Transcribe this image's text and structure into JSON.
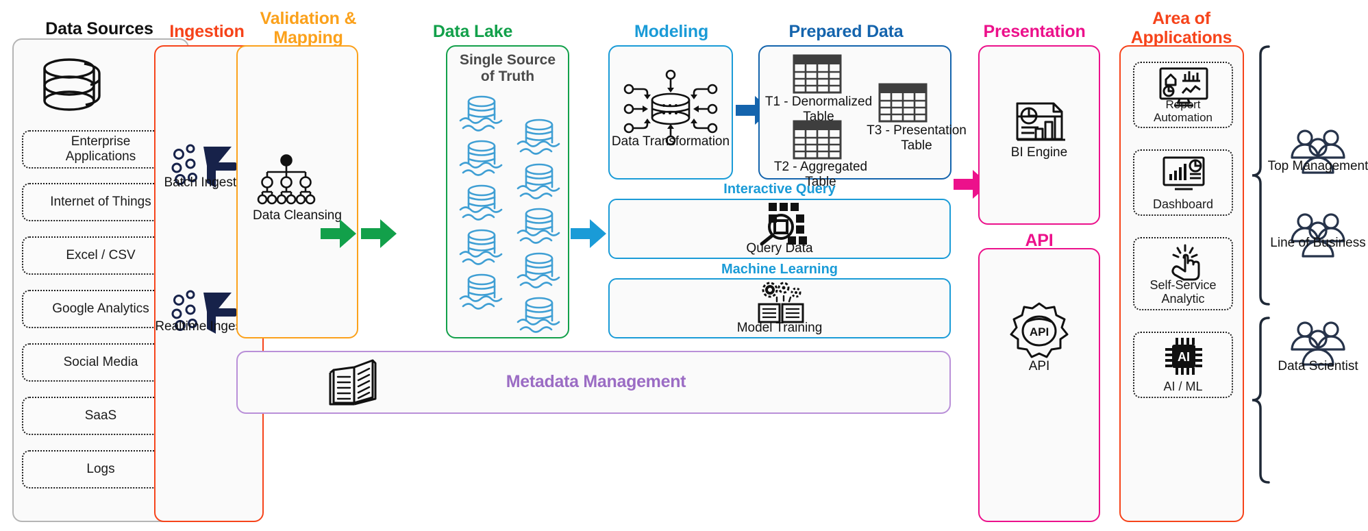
{
  "columns": {
    "data_sources": {
      "title": "Data Sources",
      "title_color": "#111111",
      "border_color": "#b5b5b5",
      "icon": "database-stack-icon",
      "items": [
        "Enterprise\nApplications",
        "Internet of Things",
        "Excel / CSV",
        "Google Analytics",
        "Social Media",
        "SaaS",
        "Logs"
      ]
    },
    "ingestion": {
      "title": "Ingestion",
      "title_color": "#f6431a",
      "border_color": "#f6431a",
      "items": [
        {
          "icon": "funnel-icon",
          "label": "Batch Ingestion"
        },
        {
          "icon": "funnel-icon",
          "label": "Realtime Ingestion"
        }
      ]
    },
    "validation": {
      "title": "Validation &\nMapping",
      "title_color": "#fba11b",
      "border_color": "#fba11b",
      "items": [
        {
          "icon": "hierarchy-tree-icon",
          "label": "Data Cleansing"
        }
      ]
    },
    "data_lake": {
      "title": "Data Lake",
      "title_color": "#12a04a",
      "border_color": "#12a04a",
      "inner_heading": "Single Source\nof Truth",
      "icon": "database-lake-icon",
      "icon_color": "#3f9fd4",
      "left_count": 5,
      "right_count": 5
    },
    "modeling": {
      "title": "Modeling",
      "title_color": "#1a9bd7",
      "border_color": "#1a9bd7",
      "items": [
        {
          "icon": "data-transformation-icon",
          "label": "Data Transformation"
        }
      ]
    },
    "prepared_data": {
      "title": "Prepared Data",
      "title_color": "#1464ad",
      "border_color": "#1464ad",
      "tables": [
        {
          "icon": "table-icon",
          "label": "T1 - Denormalized\nTable"
        },
        {
          "icon": "table-icon",
          "label": "T3 - Presentation\nTable"
        },
        {
          "icon": "table-icon",
          "label": "T2 - Aggregated\nTable"
        }
      ]
    },
    "interactive_query": {
      "title": "Interactive Query",
      "title_color": "#1a9bd7",
      "border_color": "#1a9bd7",
      "icon": "query-search-icon",
      "label": "Query Data"
    },
    "machine_learning": {
      "title": "Machine Learning",
      "title_color": "#1a9bd7",
      "border_color": "#1a9bd7",
      "icon": "model-training-icon",
      "label": "Model Training"
    },
    "metadata": {
      "label": "Metadata Management",
      "label_color": "#9b6cc4",
      "border_color": "#b98fd8",
      "icon": "open-book-icon"
    },
    "presentation": {
      "title": "Presentation",
      "title_color": "#ec118b",
      "border_color": "#ec118b",
      "icon": "bi-report-icon",
      "label": "BI Engine"
    },
    "api": {
      "title": "API",
      "title_color": "#ec118b",
      "border_color": "#ec118b",
      "icon": "api-gear-icon",
      "label": "API",
      "icon_text": "API"
    },
    "applications": {
      "title": "Area of\nApplications",
      "title_color": "#f6431a",
      "border_color": "#f6431a",
      "items": [
        {
          "icon": "report-monitor-icon",
          "label": "Report Automation"
        },
        {
          "icon": "dashboard-monitor-icon",
          "label": "Dashboard"
        },
        {
          "icon": "pointing-hand-icon",
          "label": "Self-Service\nAnalytic"
        },
        {
          "icon": "ai-chip-icon",
          "label": "AI / ML",
          "icon_text": "AI"
        }
      ]
    },
    "personas": {
      "items": [
        {
          "icon": "people-group-icon",
          "label": "Top Management"
        },
        {
          "icon": "people-group-icon",
          "label": "Line of Business"
        },
        {
          "icon": "people-group-icon",
          "label": "Data Scientist"
        }
      ]
    }
  },
  "arrows": [
    {
      "name": "arrow-sources-to-ingestion",
      "color": "#f6431a"
    },
    {
      "name": "arrow-ingestion-to-validation",
      "color": "#fba11b"
    },
    {
      "name": "arrow-validation-to-datalake",
      "color": "#12a04a"
    },
    {
      "name": "arrow-datalake-to-modeling",
      "color": "#1a9bd7"
    },
    {
      "name": "arrow-modeling-to-prepared",
      "color": "#1464ad"
    },
    {
      "name": "arrow-prepared-to-presentation",
      "color": "#ec118b"
    }
  ]
}
